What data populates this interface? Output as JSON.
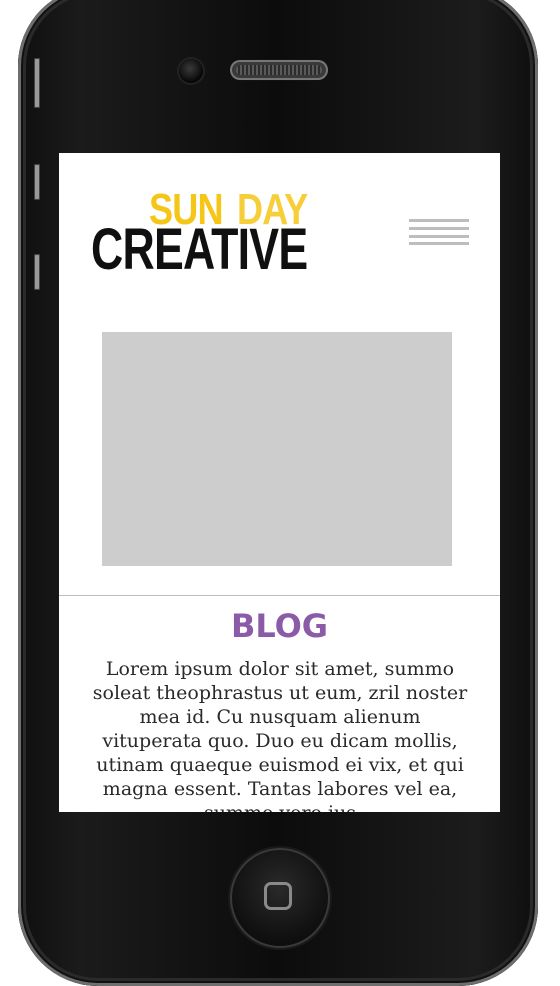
{
  "logo": {
    "line1_part1": "SUN",
    "line1_part2": "DAY",
    "line2": "CREATIVE"
  },
  "menu": {
    "icon": "hamburger-menu-icon"
  },
  "blog": {
    "heading": "BLOG",
    "body": "Lorem ipsum dolor sit amet, summo soleat theophrastus ut eum, zril noster mea id. Cu nusquam alienum vituperata quo. Duo eu dicam mollis, utinam quaeque euismod ei vix, et qui magna essent. Tantas labores vel ea, summo vero ius"
  },
  "colors": {
    "logo_accent": "#f5c617",
    "logo_main": "#101010",
    "heading": "#8c5ba8",
    "placeholder": "#cdcdcd",
    "device_body": "#111111"
  }
}
